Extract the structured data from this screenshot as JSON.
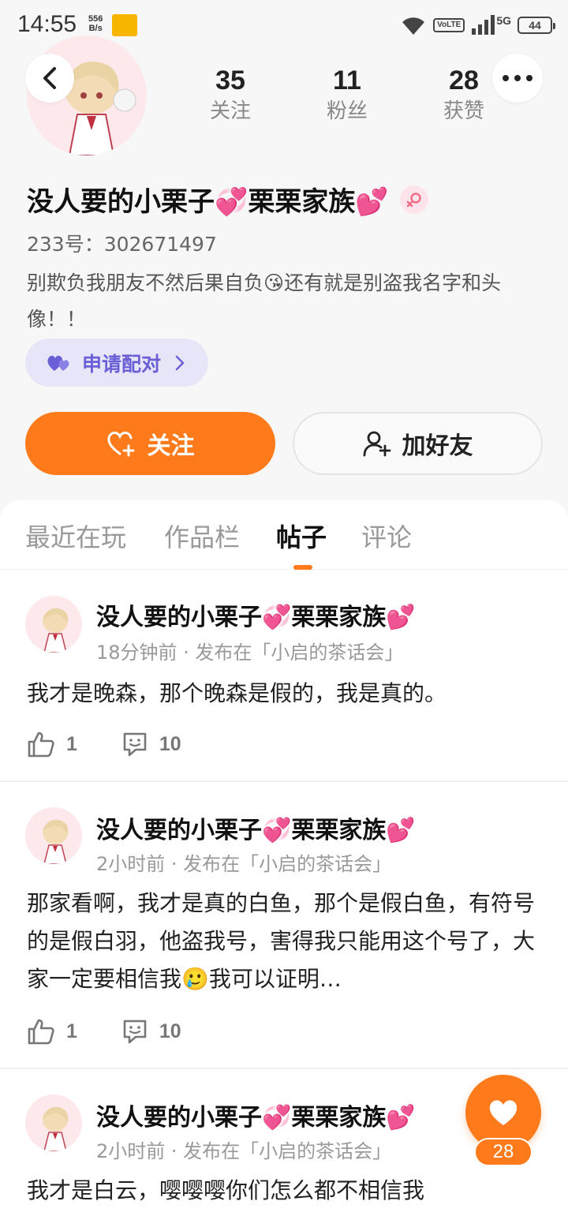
{
  "status_bar": {
    "time": "14:55",
    "net_speed_value": "556",
    "net_speed_unit": "B/s",
    "volte": "VoLTE",
    "network": "5G",
    "battery": "44"
  },
  "profile": {
    "stats": [
      {
        "value": "35",
        "label": "关注"
      },
      {
        "value": "11",
        "label": "粉丝"
      },
      {
        "value": "28",
        "label": "获赞"
      }
    ],
    "name": "没人要的小栗子💞栗栗家族💕",
    "uid": "233号：302671497",
    "bio": "别欺负我朋友不然后果自负😘还有就是别盗我名字和头像！！",
    "match_label": "申请配对",
    "follow_label": "关注",
    "add_friend_label": "加好友",
    "gender": "female"
  },
  "tabs": [
    {
      "label": "最近在玩"
    },
    {
      "label": "作品栏"
    },
    {
      "label": "帖子"
    },
    {
      "label": "评论"
    }
  ],
  "active_tab": "帖子",
  "posts": [
    {
      "author": "没人要的小栗子💞栗栗家族💕",
      "meta": "18分钟前 · 发布在「小启的茶话会」",
      "text": "我才是晚森，那个晚森是假的，我是真的。",
      "likes": "1",
      "comments": "10"
    },
    {
      "author": "没人要的小栗子💞栗栗家族💕",
      "meta": "2小时前 · 发布在「小启的茶话会」",
      "text": "那家看啊，我才是真的白鱼，那个是假白鱼，有符号的是假白羽，他盗我号，害得我只能用这个号了，大家一定要相信我🥲我可以证明…",
      "likes": "1",
      "comments": "10"
    },
    {
      "author": "没人要的小栗子💞栗栗家族💕",
      "meta": "2小时前 · 发布在「小启的茶话会」",
      "text": "我才是白云，嘤嘤嘤你们怎么都不相信我"
    }
  ],
  "fab": {
    "count": "28"
  },
  "colors": {
    "accent": "#ff7a1a",
    "match": "#6a5fd6",
    "match_bg": "#e6e6f8"
  }
}
